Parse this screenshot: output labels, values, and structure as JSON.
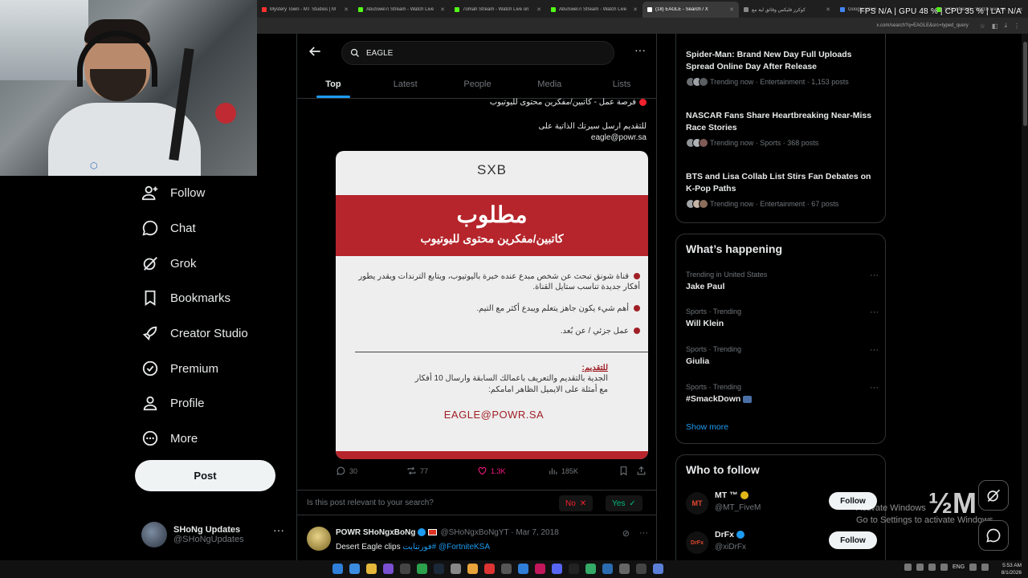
{
  "browser": {
    "tabs": [
      {
        "title": "Mystery Town - MT Studios | M",
        "color": "#ff3030"
      },
      {
        "title": "AbuSwel7i Stream - Watch Live",
        "color": "#53fc18"
      },
      {
        "title": "7omah Stream - Watch Live on",
        "color": "#53fc18"
      },
      {
        "title": "AbuSwel7i Stream - Watch Live",
        "color": "#53fc18"
      },
      {
        "title": "(18) EAGLE - Search / X",
        "color": "#ffffff",
        "active": true
      },
      {
        "title": "كوكرز فليكس وقائق لية مع",
        "color": "#888888"
      },
      {
        "title": "Google Drive",
        "color": "#4285f4"
      },
      {
        "title": "SXB Stream - Watch Live on",
        "color": "#53fc18"
      }
    ],
    "url": "x.com/search?q=EAGLE&src=typed_query"
  },
  "stats": "FPS  N/A  |  GPU  48 %  |  CPU  35 %  |  LAT  N/A",
  "nav": {
    "items": [
      {
        "label": "Follow",
        "icon": "follow-icon"
      },
      {
        "label": "Chat",
        "icon": "chat-icon"
      },
      {
        "label": "Grok",
        "icon": "grok-icon"
      },
      {
        "label": "Bookmarks",
        "icon": "bookmark-icon"
      },
      {
        "label": "Creator Studio",
        "icon": "rocket-icon"
      },
      {
        "label": "Premium",
        "icon": "verified-icon"
      },
      {
        "label": "Profile",
        "icon": "profile-icon"
      },
      {
        "label": "More",
        "icon": "more-icon"
      }
    ],
    "post_label": "Post",
    "account": {
      "name": "SHoNg Updates",
      "handle": "@SHoNgUpdates"
    }
  },
  "search": {
    "value": "EAGLE",
    "tabs": [
      "Top",
      "Latest",
      "People",
      "Media",
      "Lists"
    ]
  },
  "tweet": {
    "line1": "فرصة عمل - كاتبين/مفكرين محتوى لليوتيوب",
    "line2": "للتقديم ارسل سيرتك الذاتية على",
    "line3": "eagle@powr.sa",
    "image": {
      "logo": "SXB",
      "title": "مطلوب",
      "subtitle": "كاتبين/مفكرين محتوى لليوتيوب",
      "bullets": [
        "قناة شونق تبحث عن شخص مبدع عنده خبرة باليوتيوب، ويتابع الترندات ويقدر يطور أفكار جديدة تناسب ستايل القناة.",
        "أهم شيء يكون جاهز يتعلم ويبدع أكثر مع التيم.",
        "عمل جزئي / عن بُعد."
      ],
      "apply_heading": "للتقديم:",
      "apply_line1": "الجدية بالتقديم والتعريف باعمالك السابقة وارسال 10 أفكار",
      "apply_line2": "مع أمثلة على الايميل الظاهر امامكم:",
      "email": "EAGLE@POWR.SA"
    },
    "actions": {
      "replies": "30",
      "reposts": "77",
      "likes": "1.3K",
      "views": "185K"
    }
  },
  "relevance": {
    "question": "Is this post relevant to your search?",
    "no": "No",
    "yes": "Yes"
  },
  "tweet2": {
    "name": "POWR SHoNgxBoNg",
    "handle": "@SHoNgxBoNgYT",
    "date": "Mar 7, 2018",
    "text": "Desert Eagle clips",
    "hashtag": "فورتنايت#",
    "mention": "@FortniteKSA"
  },
  "news": [
    {
      "title": "Spider-Man: Brand New Day Full Uploads Spread Online Day After Release",
      "meta": "Trending now · Entertainment · 1,153 posts"
    },
    {
      "title": "NASCAR Fans Share Heartbreaking Near-Miss Race Stories",
      "meta": "Trending now · Sports · 368 posts"
    },
    {
      "title": "BTS and Lisa Collab List Stirs Fan Debates on K-Pop Paths",
      "meta": "Trending now · Entertainment · 67 posts"
    }
  ],
  "whats_happening": {
    "title": "What’s happening",
    "items": [
      {
        "category": "Trending in United States",
        "name": "Jake Paul"
      },
      {
        "category": "Sports · Trending",
        "name": "Will Klein"
      },
      {
        "category": "Sports · Trending",
        "name": "Giulia"
      },
      {
        "category": "Sports · Trending",
        "name": "#SmackDown"
      }
    ],
    "show_more": "Show more"
  },
  "who_to_follow": {
    "title": "Who to follow",
    "items": [
      {
        "name": "MT ™",
        "handle": "@MT_FiveM",
        "avatar": "MT",
        "button": "Follow"
      },
      {
        "name": "DrFx",
        "handle": "@xiDrFx",
        "avatar": "DrFx",
        "button": "Follow"
      }
    ]
  },
  "watermark": {
    "line1": "Activate Windows",
    "line2": "Go to Settings to activate Windows.",
    "logo": "½M"
  },
  "taskbar": {
    "lang": "ENG",
    "time": "5:53 AM",
    "date": "8/1/2026"
  },
  "colors": {
    "accent": "#1d9bf0",
    "like": "#f91880",
    "brand_red": "#b5252b"
  }
}
